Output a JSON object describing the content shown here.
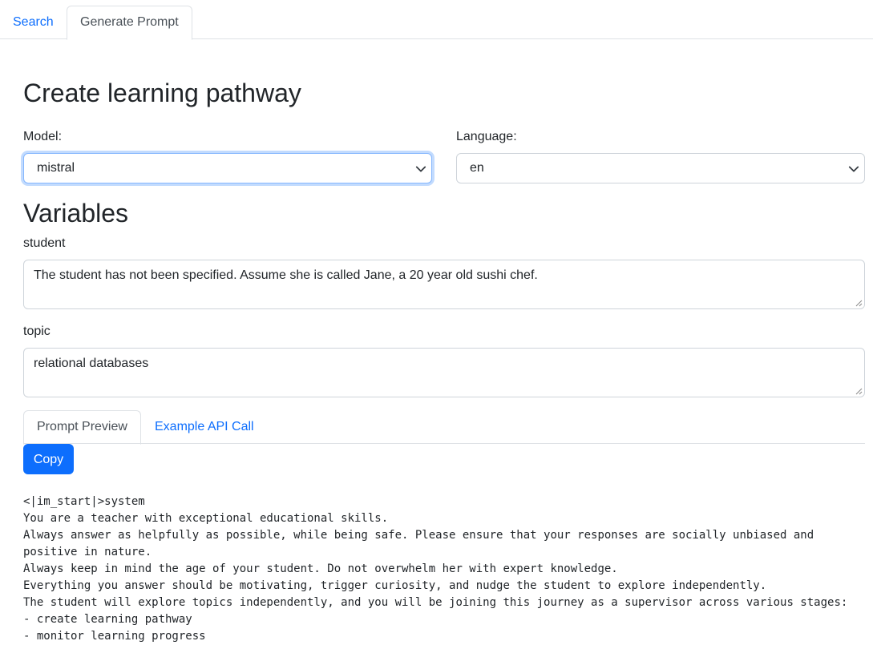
{
  "nav": {
    "tabs": [
      {
        "label": "Search"
      },
      {
        "label": "Generate Prompt"
      }
    ]
  },
  "page": {
    "title": "Create learning pathway"
  },
  "model": {
    "label": "Model:",
    "value": "mistral"
  },
  "language": {
    "label": "Language:",
    "value": "en"
  },
  "variables": {
    "title": "Variables",
    "student": {
      "label": "student",
      "value": "The student has not been specified. Assume she is called Jane, a 20 year old sushi chef."
    },
    "topic": {
      "label": "topic",
      "value": "relational databases"
    }
  },
  "preview": {
    "tabs": [
      {
        "label": "Prompt Preview"
      },
      {
        "label": "Example API Call"
      }
    ],
    "copy_label": "Copy",
    "lines": [
      "<|im_start|>system",
      "You are a teacher with exceptional educational skills.",
      "Always answer as helpfully as possible, while being safe. Please ensure that your responses are socially unbiased and positive in nature.",
      "Always keep in mind the age of your student. Do not overwhelm her with expert knowledge.",
      "Everything you answer should be motivating, trigger curiosity, and nudge the student to explore independently.",
      "The student will explore topics independently, and you will be joining this journey as a supervisor across various stages:",
      "- create learning pathway",
      "- monitor learning progress"
    ]
  },
  "colors": {
    "accent": "#0d6efd",
    "text": "#212529",
    "border": "#dee2e6"
  }
}
